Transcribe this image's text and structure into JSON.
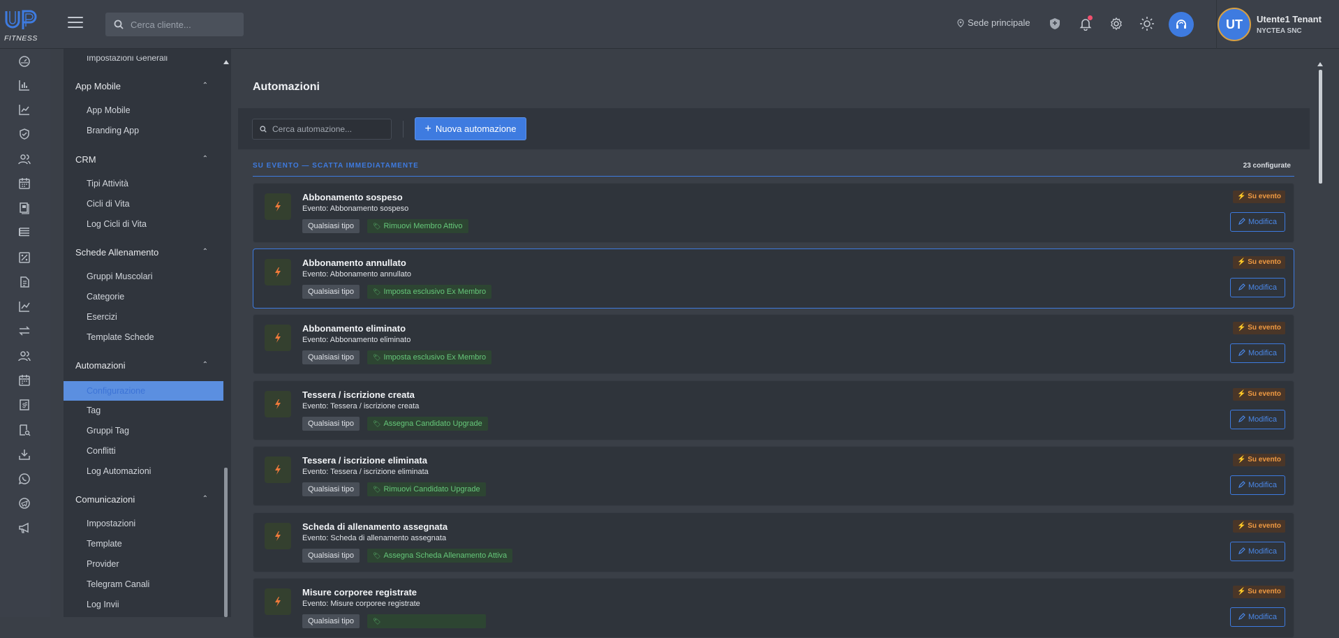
{
  "brand": {
    "logo_text": "FITNESS",
    "accent": "#3e7be0"
  },
  "topbar": {
    "search_placeholder": "Cerca cliente...",
    "location_label": "Sede principale",
    "icons": [
      "shield-icon",
      "bell-icon",
      "gear-icon",
      "sun-icon",
      "headset-icon"
    ],
    "notification_dot_color": "#f0506e"
  },
  "user": {
    "initials": "UT",
    "name": "Utente1 Tenant",
    "organization": "NYCTEA SNC"
  },
  "icon_rail": [
    "dashboard-icon",
    "bar-chart-icon",
    "line-chart-icon",
    "shield-check-icon",
    "users-icon",
    "calendar-icon",
    "book-icon",
    "list-icon",
    "percent-icon",
    "document-icon",
    "trend-icon",
    "transfer-icon",
    "group-icon",
    "calendar-check-icon",
    "invoice-icon",
    "report-search-icon",
    "download-icon",
    "whatsapp-icon",
    "telegram-icon",
    "megaphone-icon"
  ],
  "sidebar": {
    "cut_item": "Impostazioni Generali",
    "sections": [
      {
        "label": "App Mobile",
        "items": [
          "App Mobile",
          "Branding App"
        ]
      },
      {
        "label": "CRM",
        "items": [
          "Tipi Attività",
          "Cicli di Vita",
          "Log Cicli di Vita"
        ]
      },
      {
        "label": "Schede Allenamento",
        "items": [
          "Gruppi Muscolari",
          "Categorie",
          "Esercizi",
          "Template Schede"
        ]
      },
      {
        "label": "Automazioni",
        "active_item": "Configurazione",
        "items": [
          "Tag",
          "Gruppi Tag",
          "Conflitti",
          "Log Automazioni"
        ]
      },
      {
        "label": "Comunicazioni",
        "items": [
          "Impostazioni",
          "Template",
          "Provider",
          "Telegram Canali",
          "Log Invii"
        ]
      }
    ]
  },
  "main": {
    "title": "Automazioni",
    "search_placeholder": "Cerca automazione...",
    "new_button": "Nuova automazione",
    "group_title": "SU EVENTO — SCATTA IMMEDIATAMENTE",
    "group_count": "23 configurate",
    "badge_label": "Su evento",
    "edit_label": "Modifica",
    "cards": [
      {
        "title": "Abbonamento sospeso",
        "event": "Evento: Abbonamento sospeso",
        "type": "Qualsiasi tipo",
        "action": "Rimuovi Membro Attivo"
      },
      {
        "title": "Abbonamento annullato",
        "event": "Evento: Abbonamento annullato",
        "type": "Qualsiasi tipo",
        "action": "Imposta esclusivo Ex Membro"
      },
      {
        "title": "Abbonamento eliminato",
        "event": "Evento: Abbonamento eliminato",
        "type": "Qualsiasi tipo",
        "action": "Imposta esclusivo Ex Membro"
      },
      {
        "title": "Tessera / iscrizione creata",
        "event": "Evento: Tessera / iscrizione creata",
        "type": "Qualsiasi tipo",
        "action": "Assegna Candidato Upgrade"
      },
      {
        "title": "Tessera / iscrizione eliminata",
        "event": "Evento: Tessera / iscrizione eliminata",
        "type": "Qualsiasi tipo",
        "action": "Rimuovi Candidato Upgrade"
      },
      {
        "title": "Scheda di allenamento assegnata",
        "event": "Evento: Scheda di allenamento assegnata",
        "type": "Qualsiasi tipo",
        "action": "Assegna Scheda Allenamento Attiva"
      },
      {
        "title": "Misure corporee registrate",
        "event": "Evento: Misure corporee registrate",
        "type": "Qualsiasi tipo",
        "action": ""
      }
    ]
  }
}
